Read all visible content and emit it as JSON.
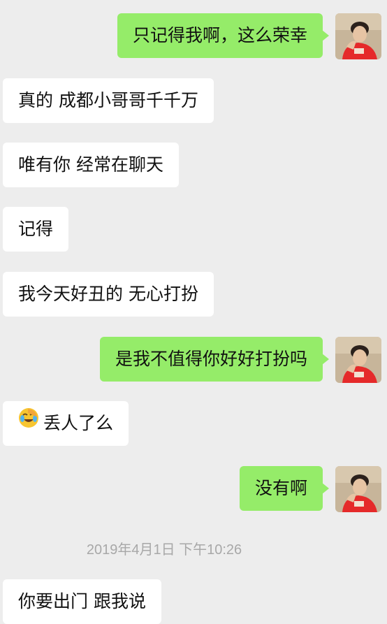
{
  "messages": [
    {
      "side": "out",
      "text": "只记得我啊，这么荣幸"
    },
    {
      "side": "in",
      "text": "真的 成都小哥哥千千万"
    },
    {
      "side": "in",
      "text": "唯有你 经常在聊天"
    },
    {
      "side": "in",
      "text": "记得"
    },
    {
      "side": "in",
      "text": "我今天好丑的 无心打扮"
    },
    {
      "side": "out",
      "text": "是我不值得你好好打扮吗"
    },
    {
      "side": "in",
      "text": "丢人了么",
      "emoji": "facepalm-laugh-emoji"
    },
    {
      "side": "out",
      "text": "没有啊"
    },
    {
      "side": "in",
      "text": "你要出门 跟我说"
    }
  ],
  "timestamp": "2019年4月1日 下午10:26",
  "colors": {
    "background": "#ededed",
    "incoming_bubble": "#ffffff",
    "outgoing_bubble": "#95ec69",
    "timestamp_text": "#a8a8a8"
  }
}
